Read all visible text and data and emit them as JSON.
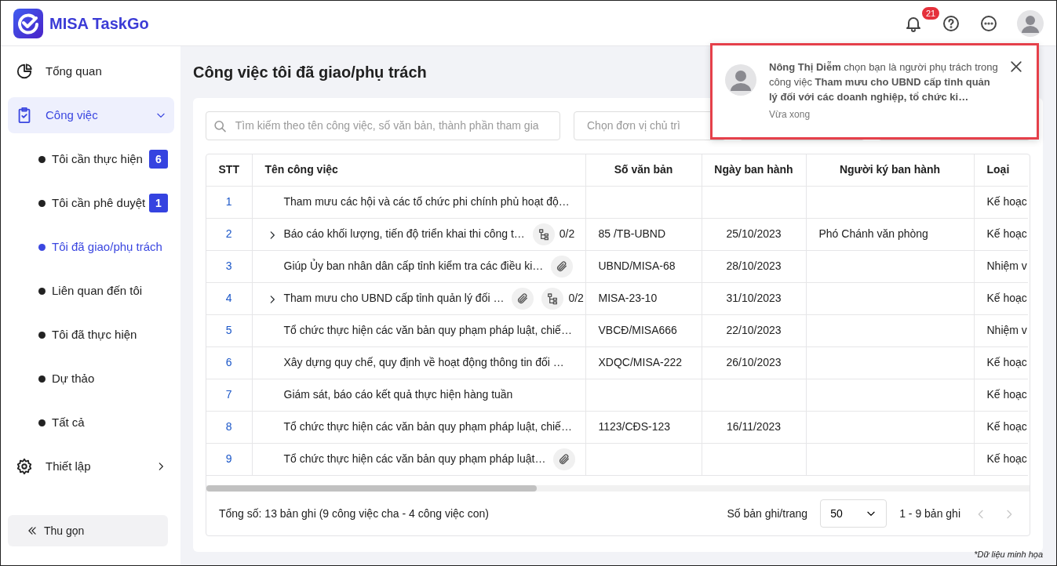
{
  "app": {
    "name": "MISA TaskGo"
  },
  "header": {
    "notification_count": "21"
  },
  "sidebar": {
    "items": [
      {
        "label": "Tổng quan",
        "kind": "link",
        "selected": false
      },
      {
        "label": "Công việc",
        "kind": "group",
        "selected": true,
        "expanded": true,
        "children": [
          {
            "label": "Tôi cần thực hiện",
            "count": "6",
            "selected": false
          },
          {
            "label": "Tôi cần phê duyệt",
            "count": "1",
            "selected": false
          },
          {
            "label": "Tôi đã giao/phụ trách",
            "selected": true
          },
          {
            "label": "Liên quan đến tôi",
            "selected": false
          },
          {
            "label": "Tôi đã thực hiện",
            "selected": false
          },
          {
            "label": "Dự thảo",
            "selected": false
          },
          {
            "label": "Tất cả",
            "selected": false
          }
        ]
      },
      {
        "label": "Thiết lập",
        "kind": "group",
        "selected": false,
        "expanded": false
      }
    ],
    "collapse_button": "Thu gọn"
  },
  "page": {
    "title": "Công việc tôi đã giao/phụ trách",
    "search": {
      "placeholder": "Tìm kiếm theo tên công việc, số văn bản, thành phần tham gia"
    },
    "filters": [
      {
        "placeholder": "Chọn đơn vị chủ trì"
      }
    ],
    "table": {
      "columns": [
        "STT",
        "Tên công việc",
        "Số văn bản",
        "Ngày ban hành",
        "Người ký ban hành",
        "Loại"
      ],
      "rows": [
        {
          "stt": "1",
          "title": "Tham mưu các hội và các tổ chức phi chính phủ hoạt độ…",
          "expandable": false,
          "attachment": false,
          "doc_no": "",
          "date": "",
          "signer": "",
          "type": "Kế hoạc"
        },
        {
          "stt": "2",
          "title": "Báo cáo khối lượng, tiến độ triển khai thi công t…",
          "expandable": true,
          "attachment": false,
          "subtasks": "0/2",
          "doc_no": "85 /TB-UBND",
          "date": "25/10/2023",
          "signer": "Phó Chánh văn phòng",
          "type": "Kế hoạc"
        },
        {
          "stt": "3",
          "title": "Giúp Ủy ban nhân dân cấp tỉnh kiểm tra các điều ki…",
          "expandable": false,
          "attachment": true,
          "doc_no": "UBND/MISA-68",
          "date": "28/10/2023",
          "signer": "",
          "type": "Nhiệm v"
        },
        {
          "stt": "4",
          "title": "Tham mưu cho UBND cấp tỉnh quản lý đối …",
          "expandable": true,
          "attachment": true,
          "subtasks": "0/2",
          "doc_no": "MISA-23-10",
          "date": "31/10/2023",
          "signer": "",
          "type": "Kế hoạc"
        },
        {
          "stt": "5",
          "title": "Tổ chức thực hiện các văn bản quy phạm pháp luật, chiế…",
          "expandable": false,
          "attachment": false,
          "doc_no": "VBCĐ/MISA666",
          "date": "22/10/2023",
          "signer": "",
          "type": "Nhiệm v"
        },
        {
          "stt": "6",
          "title": "Xây dựng quy chế, quy định về hoạt động thông tin đối …",
          "expandable": false,
          "attachment": false,
          "doc_no": "XDQC/MISA-222",
          "date": "26/10/2023",
          "signer": "",
          "type": "Kế hoạc"
        },
        {
          "stt": "7",
          "title": "Giám sát, báo cáo kết quả thực hiện hàng tuần",
          "expandable": false,
          "attachment": false,
          "doc_no": "",
          "date": "",
          "signer": "",
          "type": "Kế hoạc"
        },
        {
          "stt": "8",
          "title": "Tổ chức thực hiện các văn bản quy phạm pháp luật, chiế…",
          "expandable": false,
          "attachment": false,
          "doc_no": "1123/CĐS-123",
          "date": "16/11/2023",
          "signer": "",
          "type": "Kế hoạc"
        },
        {
          "stt": "9",
          "title": "Tổ chức thực hiện các văn bản quy phạm pháp luật…",
          "expandable": false,
          "attachment": true,
          "doc_no": "",
          "date": "",
          "signer": "",
          "type": "Kế hoạc"
        }
      ]
    },
    "footer": {
      "total": "Tổng số: 13 bản ghi (9 công việc cha - 4 công việc con)",
      "page_size_label": "Số bản ghi/trang",
      "page_size": "50",
      "range": "1 - 9 bản ghi",
      "prev_disabled": true,
      "next_disabled": true
    }
  },
  "notification": {
    "message": "**Nông Thị Diễm** chọn bạn là người phụ trách trong công việc **Tham mưu cho UBND cấp tỉnh quản lý đối với các doanh nghiệp, tổ chức ki…**",
    "time": "Vừa xong",
    "highlighted": true
  },
  "footnote": "*Dữ liệu minh họa"
}
